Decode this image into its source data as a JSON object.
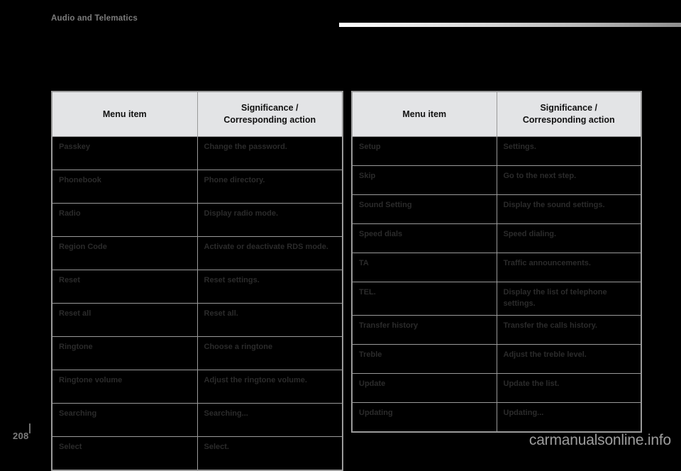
{
  "header": {
    "chapter_title": "Audio and Telematics"
  },
  "columns": {
    "menu_item": "Menu item",
    "significance_line1": "Significance /",
    "significance_line2": "Corresponding action"
  },
  "tables": [
    {
      "id": "left",
      "rows": [
        {
          "item": "Passkey",
          "action": "Change the password."
        },
        {
          "item": "Phonebook",
          "action": "Phone directory."
        },
        {
          "item": "Radio",
          "action": "Display radio mode."
        },
        {
          "item": "Region Code",
          "action": "Activate or deactivate RDS mode."
        },
        {
          "item": "Reset",
          "action": "Reset settings."
        },
        {
          "item": "Reset all",
          "action": "Reset all."
        },
        {
          "item": "Ringtone",
          "action": "Choose a ringtone"
        },
        {
          "item": "Ringtone volume",
          "action": "Adjust the ringtone volume."
        },
        {
          "item": "Searching",
          "action": "Searching..."
        },
        {
          "item": "Select",
          "action": "Select."
        }
      ]
    },
    {
      "id": "right",
      "rows": [
        {
          "item": "Setup",
          "action": "Settings."
        },
        {
          "item": "Skip",
          "action": "Go to the next step."
        },
        {
          "item": "Sound Setting",
          "action": "Display the sound settings."
        },
        {
          "item": "Speed dials",
          "action": "Speed dialing."
        },
        {
          "item": "TA",
          "action": "Traffic announcements."
        },
        {
          "item": "TEL.",
          "action": "Display the list of telephone settings."
        },
        {
          "item": "Transfer history",
          "action": "Transfer the calls history."
        },
        {
          "item": "Treble",
          "action": "Adjust the treble level."
        },
        {
          "item": "Update",
          "action": "Update the list."
        },
        {
          "item": "Updating",
          "action": "Updating..."
        }
      ]
    }
  ],
  "footer": {
    "page_number": "208",
    "watermark": "carmanualsonline.info"
  }
}
